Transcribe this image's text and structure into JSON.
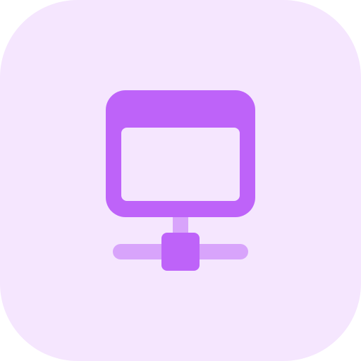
{
  "icon": {
    "name": "network-server-icon",
    "colors": {
      "tile_background": "#F5E6FE",
      "primary": "#BE63F9",
      "secondary": "#D8A4FB",
      "screen_fill": "#F5E6FE"
    }
  }
}
